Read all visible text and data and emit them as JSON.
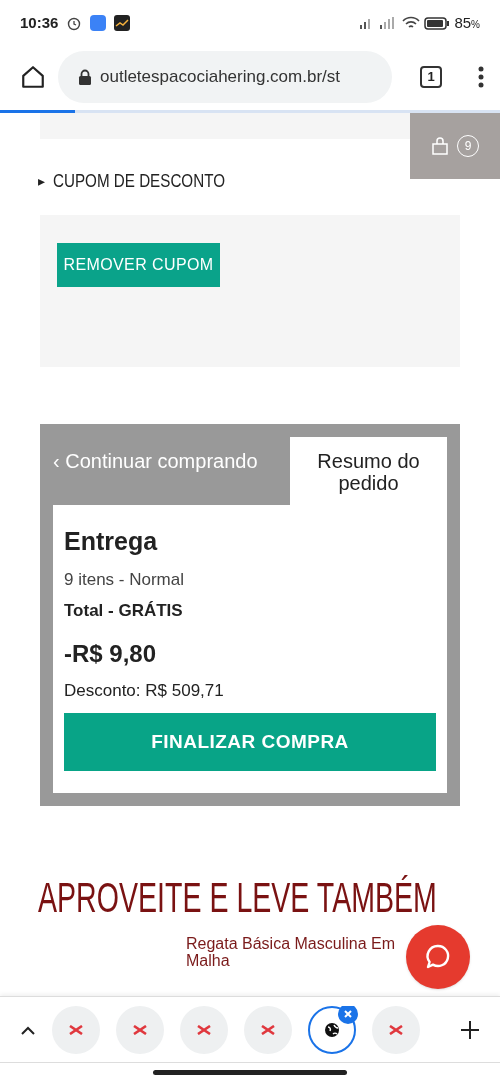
{
  "status_bar": {
    "time": "10:36",
    "battery": "85",
    "battery_unit": "%"
  },
  "browser": {
    "url": "outletespacociahering.com.br/st",
    "tab_count": "1",
    "page_load": {
      "level": 0.15
    }
  },
  "cart": {
    "count": "9"
  },
  "coupon": {
    "toggle": "▸",
    "label": "CUPOM DE DESCONTO",
    "button": "REMOVER CUPOM"
  },
  "order_tabs": [
    {
      "label": "‹ Continuar comprando",
      "selected": false
    },
    {
      "label": "Resumo do pedido",
      "selected": true
    }
  ],
  "summary": {
    "title": "Entrega",
    "items": "9 itens - Normal",
    "shipping": "Total - GRÁTIS",
    "total": "-R$ 9,80",
    "discount": "Desconto: R$ 509,71",
    "button": "FINALIZAR COMPRA"
  },
  "upsell": {
    "heading": "APROVEITE E LEVE TAMBÉM",
    "product": "Regata Básica Masculina Em Malha"
  },
  "tab_strip": [
    {
      "selected": false
    },
    {
      "selected": false
    },
    {
      "selected": false
    },
    {
      "selected": false
    },
    {
      "selected": true
    },
    {
      "selected": false
    }
  ]
}
